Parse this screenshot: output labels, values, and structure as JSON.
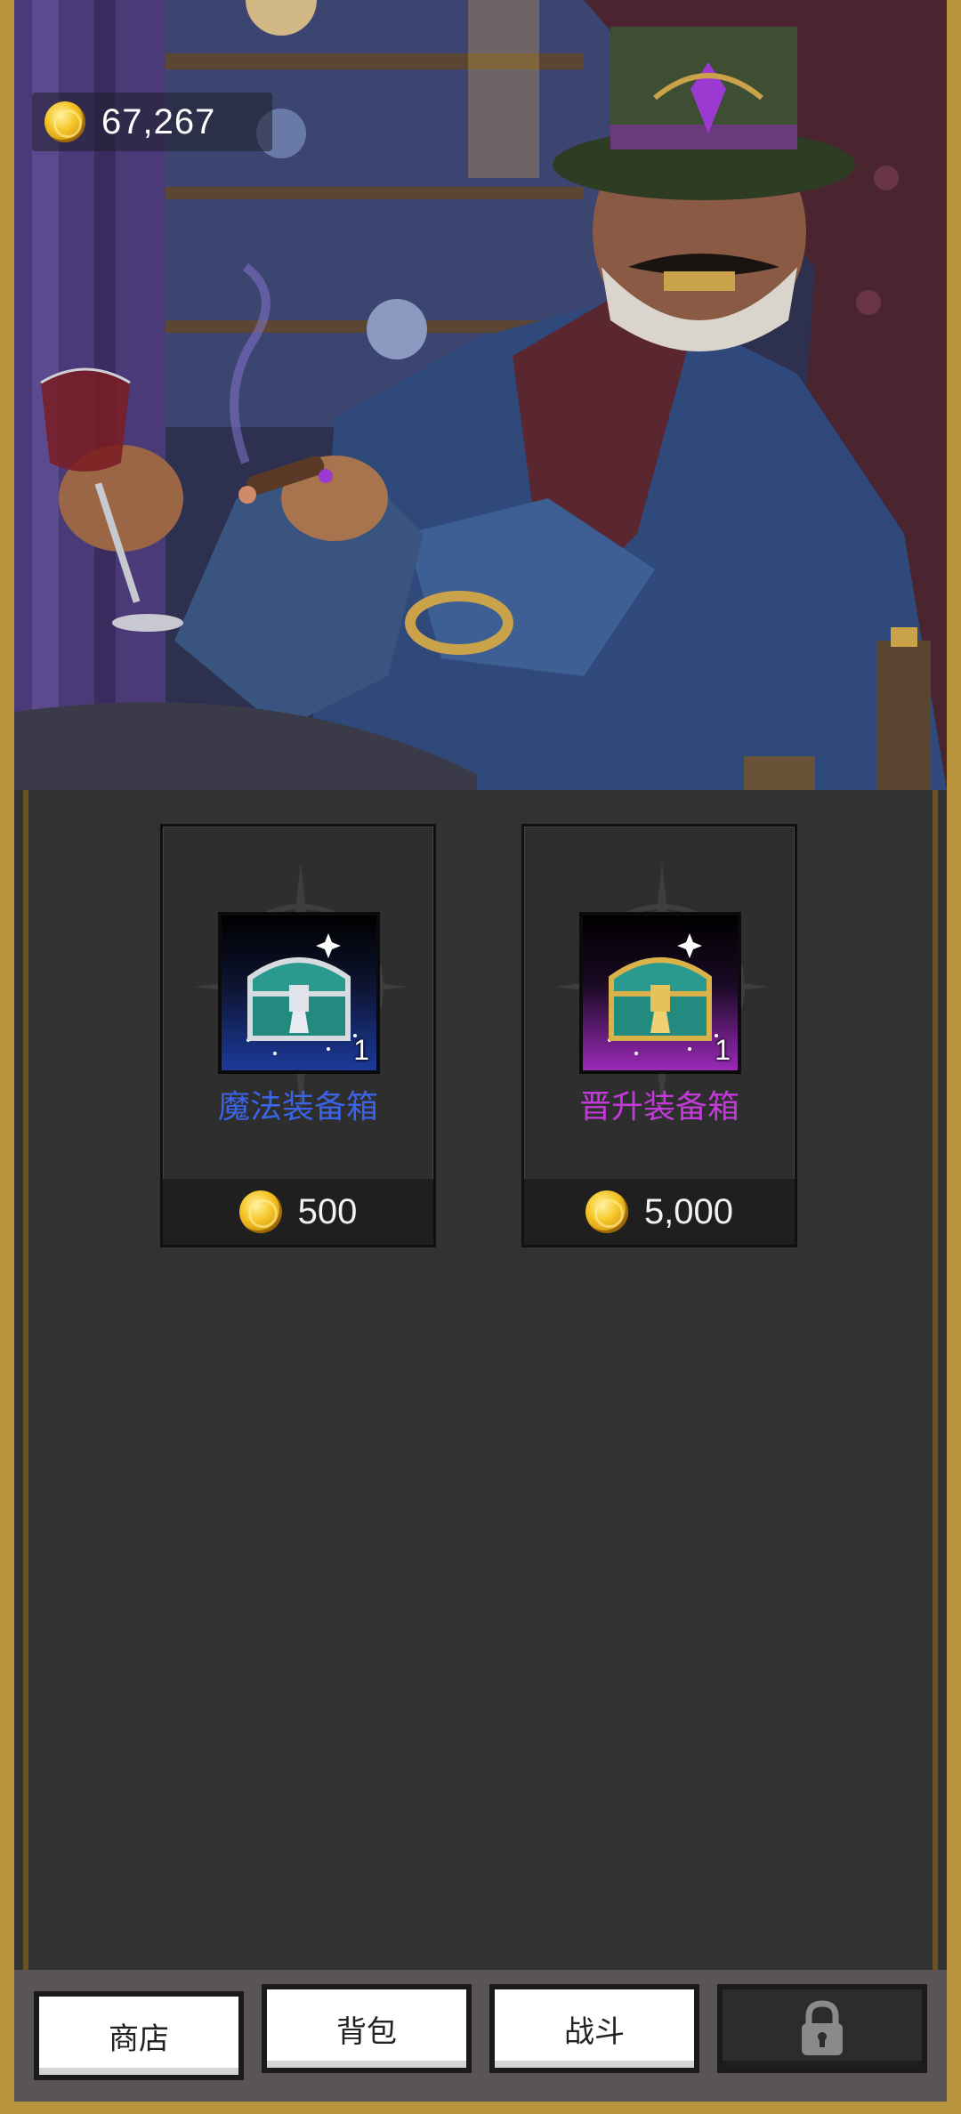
{
  "currency": {
    "gold_amount": "67,267",
    "icon": "gold-coin-icon"
  },
  "shop": {
    "items": [
      {
        "name": "魔法装备箱",
        "count": "1",
        "price": "500",
        "rarity_color": "#3a63e6",
        "icon": "silver-chest-icon"
      },
      {
        "name": "晋升装备箱",
        "count": "1",
        "price": "5,000",
        "rarity_color": "#c23ad8",
        "icon": "gold-chest-icon"
      }
    ]
  },
  "nav": {
    "shop_label": "商店",
    "bag_label": "背包",
    "battle_label": "战斗",
    "locked_icon": "lock-icon"
  }
}
